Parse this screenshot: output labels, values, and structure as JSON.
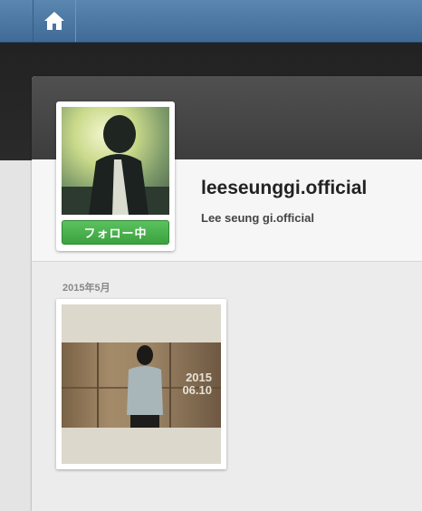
{
  "nav": {
    "home_icon": "home-icon"
  },
  "profile": {
    "username": "leeseunggi.official",
    "full_name": "Lee seung gi.official",
    "follow_button_label": "フォロー中"
  },
  "timeline": {
    "month_label": "2015年5月",
    "photos": [
      {
        "overlay_text_line1": "2015",
        "overlay_text_line2": "06.10"
      }
    ]
  },
  "colors": {
    "nav_blue": "#4a77a2",
    "follow_green": "#4cb24f",
    "text_dark": "#222222"
  }
}
